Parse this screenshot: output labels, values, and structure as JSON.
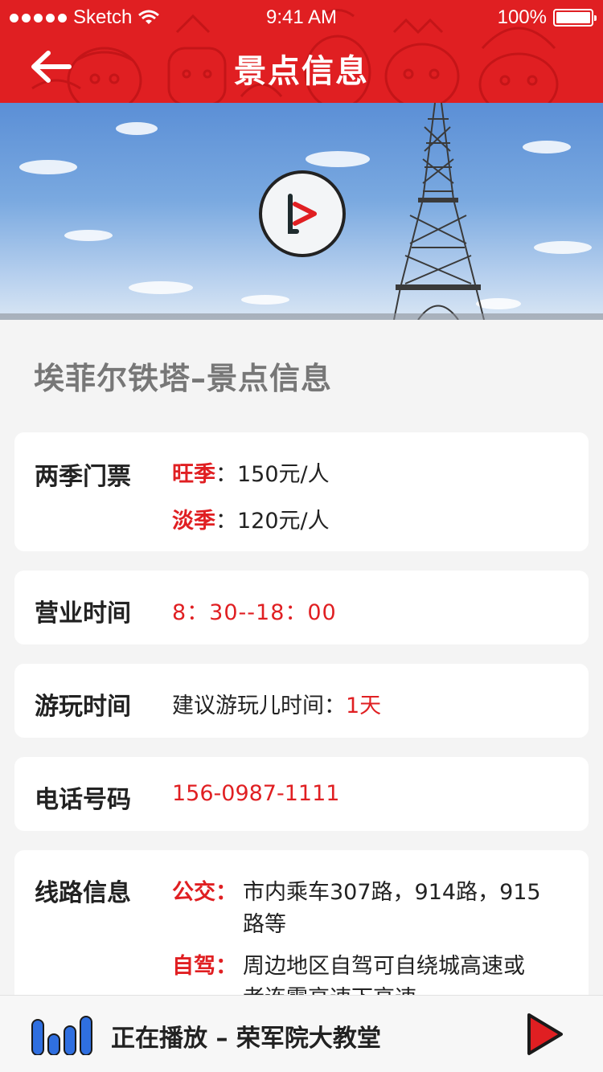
{
  "status_bar": {
    "carrier": "Sketch",
    "time": "9:41 AM",
    "battery": "100%"
  },
  "nav": {
    "title": "景点信息"
  },
  "page_title": "埃菲尔铁塔–景点信息",
  "tickets": {
    "label": "两季门票",
    "peak_label": "旺季",
    "peak_price": "：150元/人",
    "off_label": "淡季",
    "off_price": "：120元/人"
  },
  "hours": {
    "label": "营业时间",
    "value": "8：30--18：00"
  },
  "visit": {
    "label": "游玩时间",
    "prefix": "建议游玩儿时间：",
    "value": "1天"
  },
  "phone": {
    "label": "电话号码",
    "value": "156-0987-1111"
  },
  "route": {
    "label": "线路信息",
    "bus_label": "公交：",
    "bus_line1": "市内乘车307路，914路，915",
    "bus_line2": "路等",
    "drive_label": "自驾：",
    "drive_line1": "周边地区自驾可自绕城高速或",
    "drive_line2": "者连霍高速下高速"
  },
  "player": {
    "now_playing": "正在播放 – 荣军院大教堂"
  },
  "colors": {
    "brand": "#e01f22",
    "background": "#f4f4f4"
  }
}
